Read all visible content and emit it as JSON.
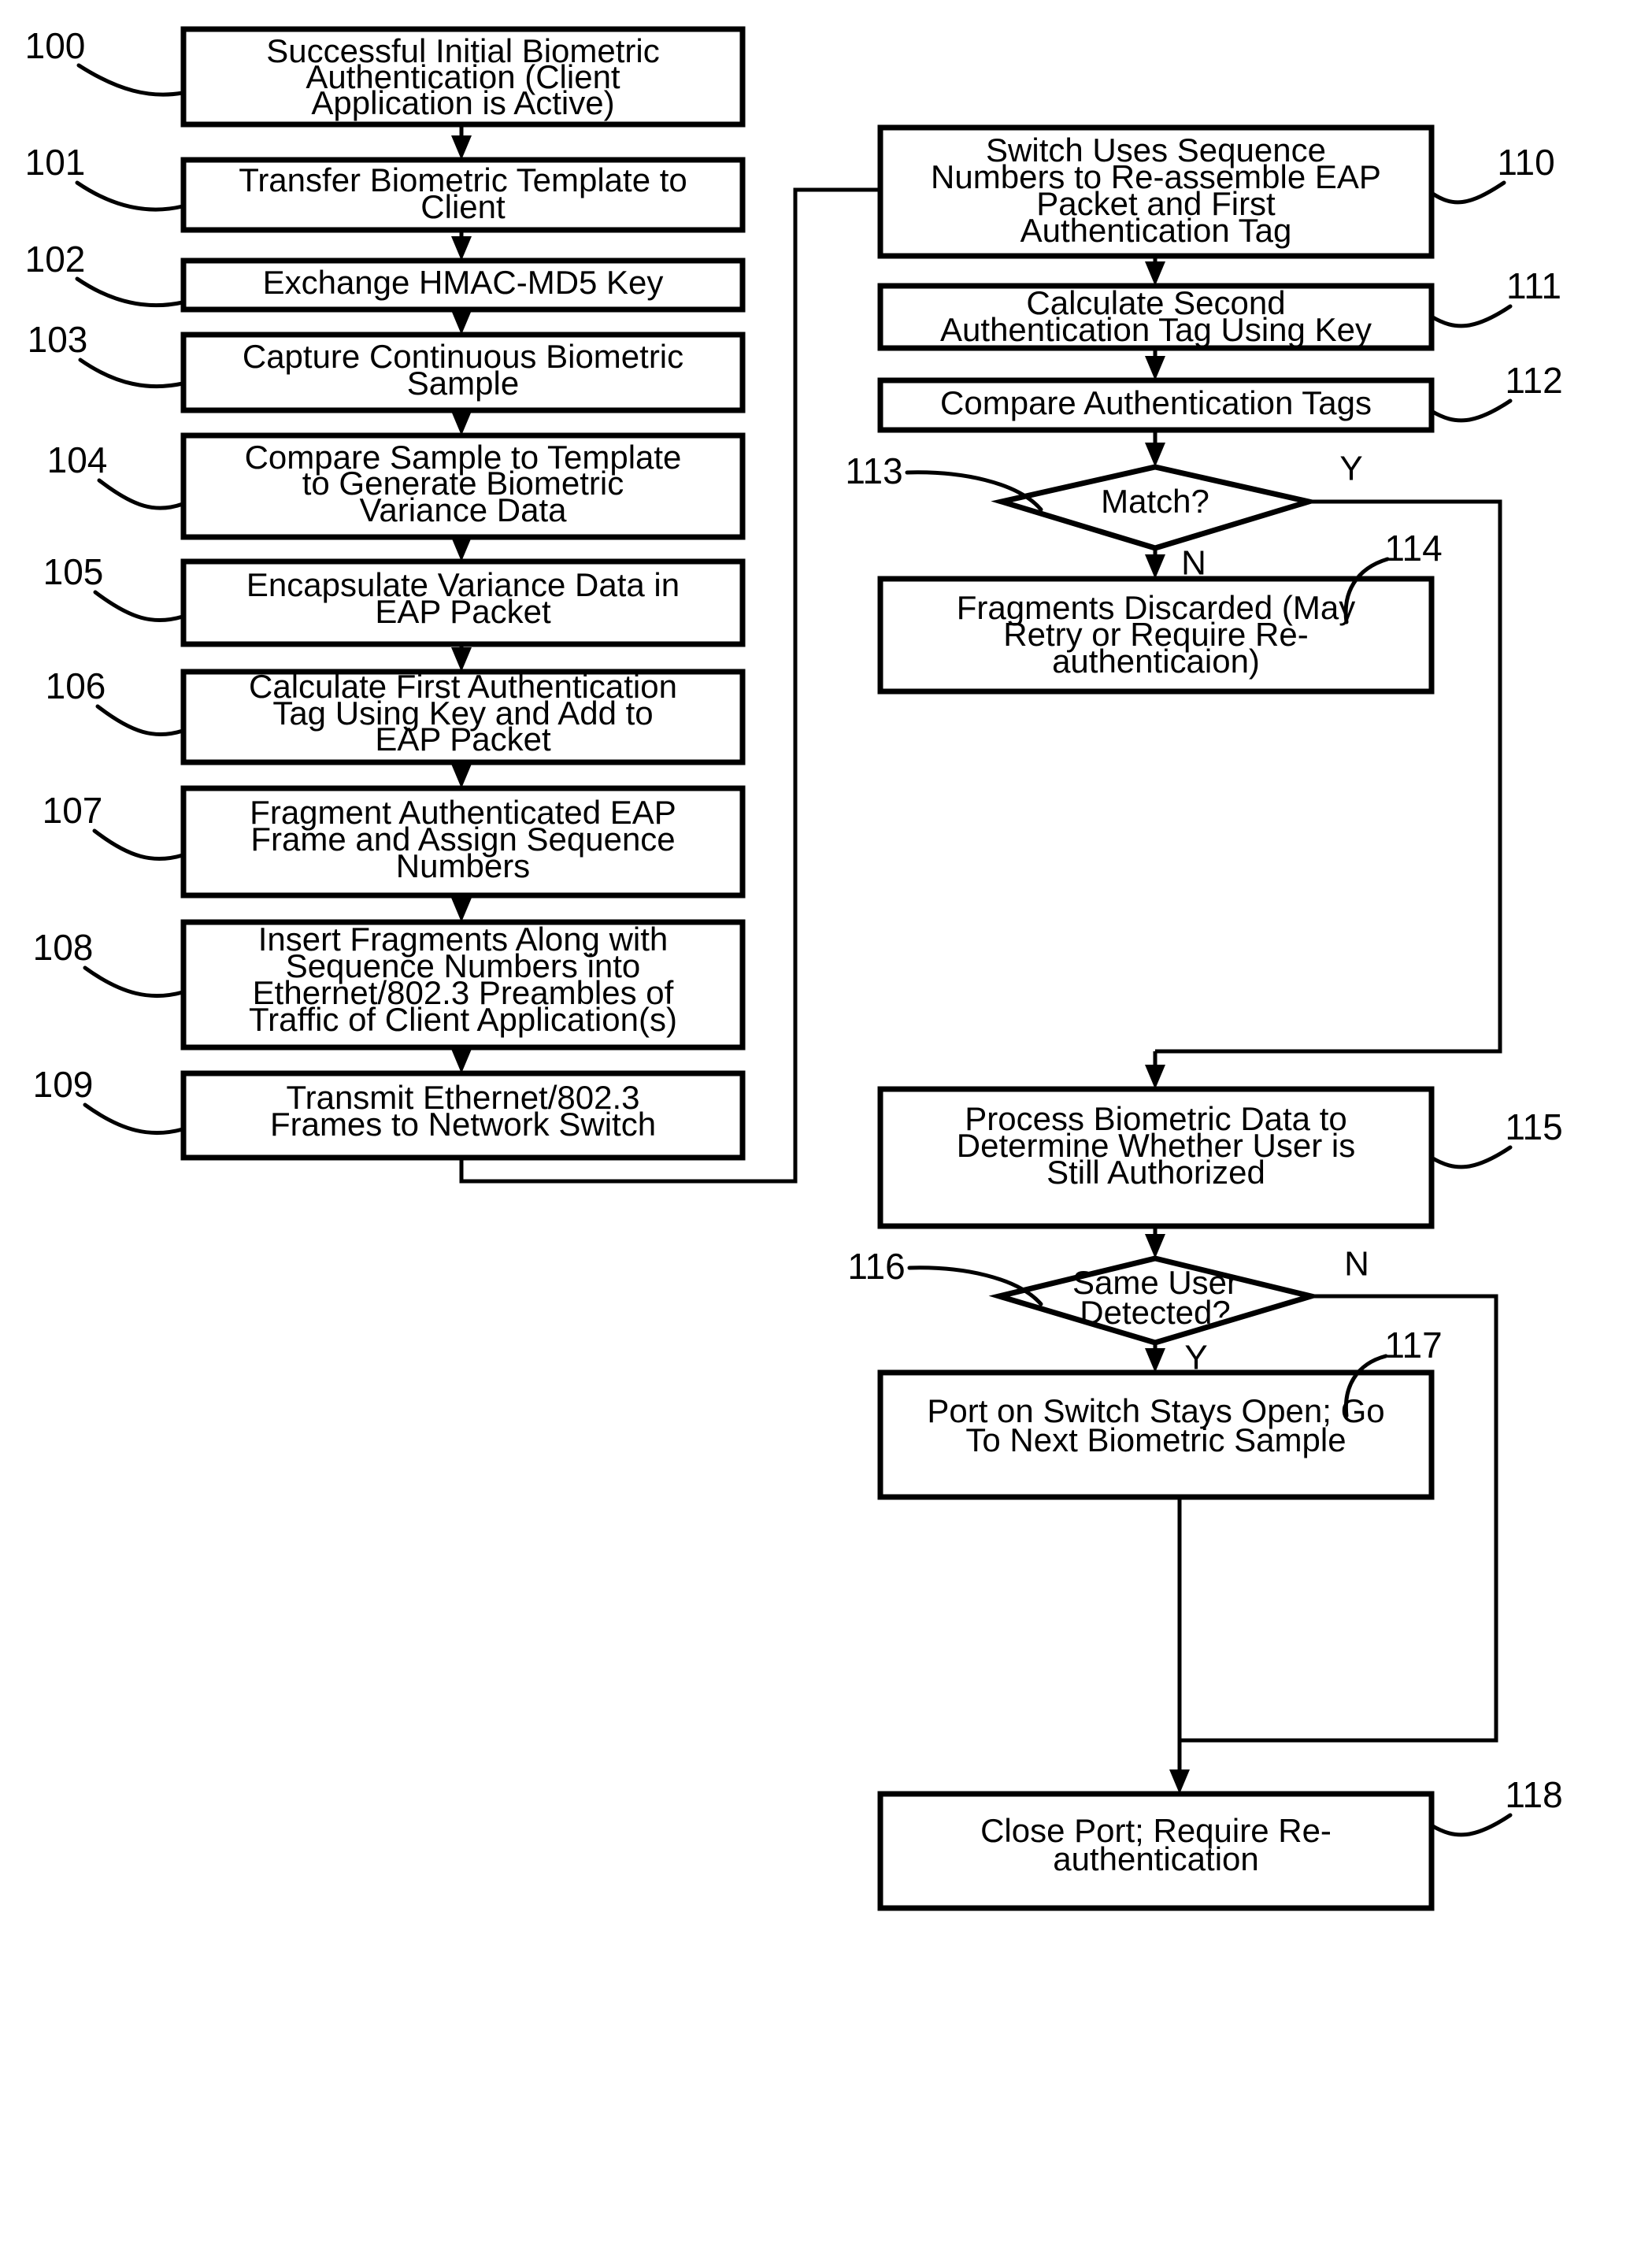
{
  "figure": {
    "type": "flowchart",
    "title": "Biometric continuous authentication over Ethernet/802.3 flowchart",
    "background_color": "#ffffff",
    "line_color": "#000000"
  },
  "nodes": [
    {
      "ref": "100",
      "shape": "process",
      "lines": [
        "Successful Initial Biometric",
        "Authentication (Client",
        "Application is Active)"
      ]
    },
    {
      "ref": "101",
      "shape": "process",
      "lines": [
        "Transfer Biometric Template to",
        "Client"
      ]
    },
    {
      "ref": "102",
      "shape": "process",
      "lines": [
        "Exchange HMAC-MD5 Key"
      ]
    },
    {
      "ref": "103",
      "shape": "process",
      "lines": [
        "Capture Continuous Biometric",
        "Sample"
      ]
    },
    {
      "ref": "104",
      "shape": "process",
      "lines": [
        "Compare Sample to Template",
        "to Generate Biometric",
        "Variance Data"
      ]
    },
    {
      "ref": "105",
      "shape": "process",
      "lines": [
        "Encapsulate Variance Data in",
        "EAP Packet"
      ]
    },
    {
      "ref": "106",
      "shape": "process",
      "lines": [
        "Calculate First Authentication",
        "Tag Using Key and Add to",
        "EAP Packet"
      ]
    },
    {
      "ref": "107",
      "shape": "process",
      "lines": [
        "Fragment Authenticated EAP",
        "Frame and Assign Sequence",
        "Numbers"
      ]
    },
    {
      "ref": "108",
      "shape": "process",
      "lines": [
        "Insert Fragments Along with",
        "Sequence Numbers into",
        "Ethernet/802.3 Preambles of",
        "Traffic of Client Application(s)"
      ]
    },
    {
      "ref": "109",
      "shape": "process",
      "lines": [
        "Transmit Ethernet/802.3",
        "Frames to Network Switch"
      ]
    },
    {
      "ref": "110",
      "shape": "process",
      "lines": [
        "Switch Uses Sequence",
        "Numbers to Re-assemble EAP",
        "Packet and First",
        "Authentication Tag"
      ]
    },
    {
      "ref": "111",
      "shape": "process",
      "lines": [
        "Calculate Second",
        "Authentication Tag Using Key"
      ]
    },
    {
      "ref": "112",
      "shape": "process",
      "lines": [
        "Compare Authentication Tags"
      ]
    },
    {
      "ref": "113",
      "shape": "decision",
      "lines": [
        "Match?"
      ]
    },
    {
      "ref": "114",
      "shape": "process",
      "lines": [
        "Fragments Discarded (May",
        "Retry or Require Re-",
        "authenticaion)"
      ]
    },
    {
      "ref": "115",
      "shape": "process",
      "lines": [
        "Process Biometric Data to",
        "Determine Whether User is",
        "Still Authorized"
      ]
    },
    {
      "ref": "116",
      "shape": "decision",
      "lines": [
        "Same User",
        "Detected?"
      ]
    },
    {
      "ref": "117",
      "shape": "process",
      "lines": [
        "Port on Switch Stays Open; Go",
        "To Next Biometric Sample"
      ]
    },
    {
      "ref": "118",
      "shape": "process",
      "lines": [
        "Close Port; Require Re-",
        "authentication"
      ]
    }
  ],
  "branch_labels": {
    "match_yes": "Y",
    "match_no": "N",
    "same_user_no": "N",
    "same_user_yes": "Y"
  }
}
